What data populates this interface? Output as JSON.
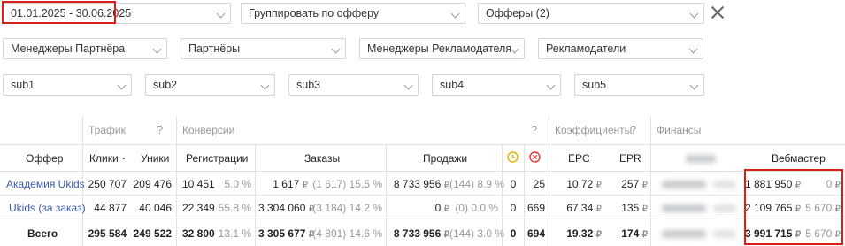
{
  "filters": {
    "period": "01.01.2025 - 30.06.2025",
    "group": "Группировать по офферу",
    "offers": "Офферы",
    "offers_count": "(2)",
    "managers_partner": "Менеджеры Партнёра",
    "partners": "Партнёры",
    "managers_advertiser": "Менеджеры Рекламодателя",
    "advertisers": "Рекламодатели",
    "sub1": "sub1",
    "sub2": "sub2",
    "sub3": "sub3",
    "sub4": "sub4",
    "sub5": "sub5"
  },
  "groups": {
    "traffic": "Трафик",
    "conversions": "Конверсии",
    "coefficients": "Коэффициенты",
    "finance": "Финансы",
    "help": "?"
  },
  "headers": {
    "offer": "Оффер",
    "clicks": "Клики",
    "uniques": "Уники",
    "registrations": "Регистрации",
    "orders": "Заказы",
    "sales": "Продажи",
    "epc": "EPC",
    "epr": "EPR",
    "webmaster": "Вебмастер"
  },
  "rows": [
    {
      "offer": "Академия Ukids",
      "clicks": "250 707",
      "uniques": "209 476",
      "reg": "10 451",
      "reg_pct": "5.0 %",
      "orders": "1 617",
      "orders_extra": "(1 617) 15.5 %",
      "sales": "8 733 956",
      "sales_extra": "(144) 8.9 %",
      "pending": "0",
      "rejected": "25",
      "epc": "10.72",
      "epr": "257",
      "web": "1 881 950",
      "web_extra": "0"
    },
    {
      "offer": "Ukids (за заказ)",
      "clicks": "44 877",
      "uniques": "40 046",
      "reg": "22 349",
      "reg_pct": "55.8 %",
      "orders": "3 304 060",
      "orders_extra": "(3 184) 14.2 %",
      "sales": "0",
      "sales_extra": "(0) 0.0 %",
      "pending": "0",
      "rejected": "669",
      "epc": "67.34",
      "epr": "135",
      "web": "2 109 765",
      "web_extra": "5 670"
    }
  ],
  "total": {
    "label": "Всего",
    "clicks": "295 584",
    "uniques": "249 522",
    "reg": "32 800",
    "reg_pct": "13.1 %",
    "orders": "3 305 677",
    "orders_extra": "(4 801) 14.6 %",
    "sales": "8 733 956",
    "sales_extra": "(144) 3.0 %",
    "pending": "0",
    "rejected": "694",
    "epc": "19.32",
    "epr": "174",
    "web": "3 991 715",
    "web_extra": "5 670"
  },
  "currency": "₽",
  "colors": {
    "highlight": "#d9211b",
    "link": "#3b5aa8",
    "pending_icon": "#e8b400",
    "rejected_icon": "#e53935"
  }
}
